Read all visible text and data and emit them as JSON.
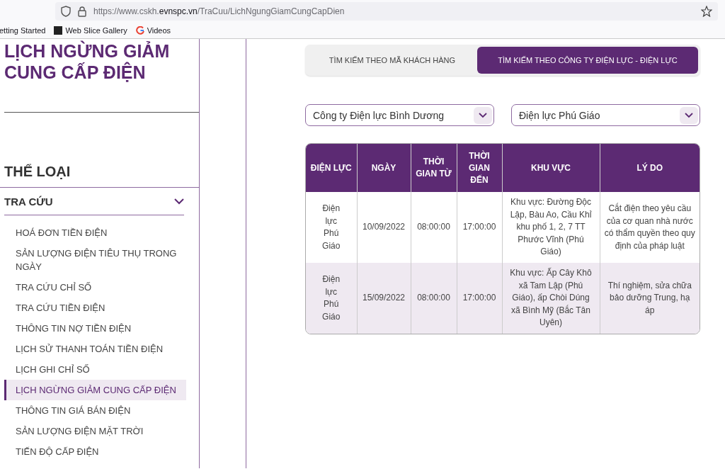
{
  "browser": {
    "url_host_pre": "https://www.cskh.",
    "url_host": "evnspc.vn",
    "url_path": "/TraCuu/LichNgungGiamCungCapDien",
    "bookmarks": [
      "etting Started",
      "Web Slice Gallery",
      "Videos"
    ]
  },
  "sidebar": {
    "title": "LỊCH NGỪNG GIẢM CUNG CẤP ĐIỆN",
    "section_title": "THỂ LOẠI",
    "group": {
      "label": "TRA CỨU",
      "expanded": true,
      "items": [
        {
          "label": "HOÁ ĐƠN TIỀN ĐIỆN",
          "selected": false
        },
        {
          "label": "SẢN LƯỢNG ĐIỆN TIÊU THỤ TRONG NGÀY",
          "selected": false
        },
        {
          "label": "TRA CỨU CHỈ SỐ",
          "selected": false
        },
        {
          "label": "TRA CỨU TIỀN ĐIỆN",
          "selected": false
        },
        {
          "label": "THÔNG TIN NỢ TIỀN ĐIỆN",
          "selected": false
        },
        {
          "label": "LỊCH SỬ THANH TOÁN TIỀN ĐIỆN",
          "selected": false
        },
        {
          "label": "LỊCH GHI CHỈ SỐ",
          "selected": false
        },
        {
          "label": "LỊCH NGỪNG GIẢM CUNG CẤP ĐIỆN",
          "selected": true
        },
        {
          "label": "THÔNG TIN GIÁ BÁN ĐIỆN",
          "selected": false
        },
        {
          "label": "SẢN LƯỢNG ĐIỆN MẶT TRỜI",
          "selected": false
        },
        {
          "label": "TIẾN ĐỘ CẤP ĐIỆN",
          "selected": false
        }
      ]
    }
  },
  "tabs": [
    {
      "label": "TÌM KIẾM THEO MÃ KHÁCH HÀNG",
      "selected": false
    },
    {
      "label": "TÌM KIẾM THEO CÔNG TY ĐIỆN LỰC - ĐIỆN LỰC",
      "selected": true
    }
  ],
  "filters": [
    {
      "value": "Công ty Điện lực Bình Dương"
    },
    {
      "value": "Điện lực Phú Giáo"
    }
  ],
  "table": {
    "columns": [
      "ĐIỆN LỰC",
      "NGÀY",
      "THỜI GIAN TỪ",
      "THỜI GIAN ĐẾN",
      "KHU VỰC",
      "LÝ DO"
    ],
    "rows": [
      [
        "Điện lực Phú Giáo",
        "10/09/2022",
        "08:00:00",
        "17:00:00",
        "Khu vực: Đường Độc Lập, Bàu Ao, Cầu Khỉ khu phố 1, 2, 7 TT Phước Vĩnh (Phú Giáo)",
        "Cắt điện theo yêu cầu của cơ quan nhà nước có thẩm quyền theo quy định của pháp luật"
      ],
      [
        "Điện lực Phú Giáo",
        "15/09/2022",
        "08:00:00",
        "17:00:00",
        "Khu vực: Ấp Cây Khô xã Tam Lập (Phú Giáo), ấp Chòi Dúng xã Bình Mỹ (Bắc Tân Uyên)",
        "Thí nghiệm, sửa chữa bảo dưỡng Trung, hạ áp"
      ]
    ]
  }
}
